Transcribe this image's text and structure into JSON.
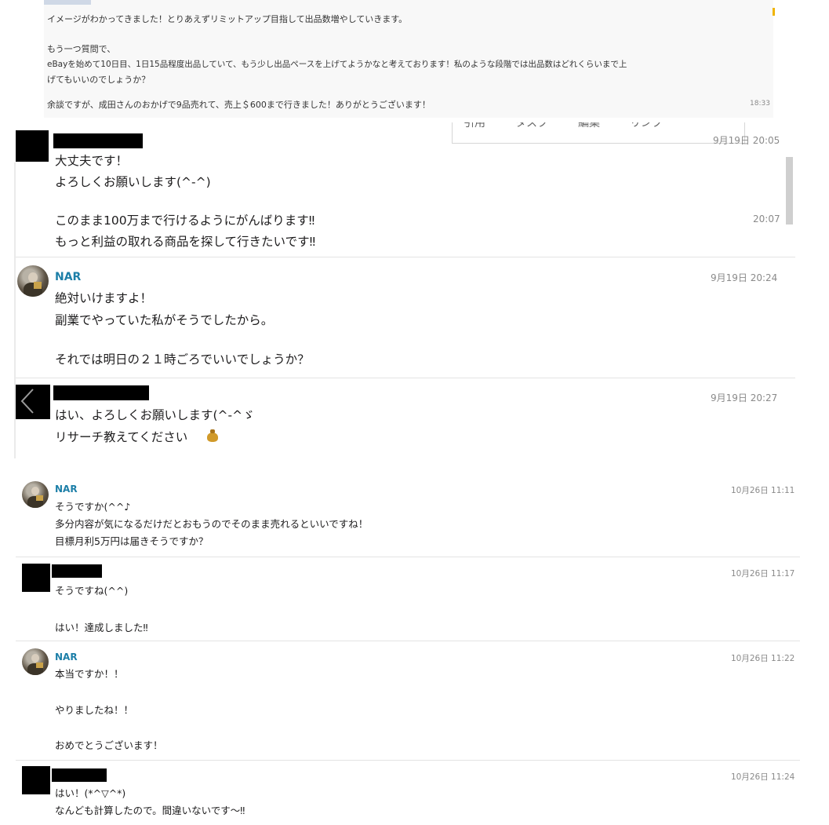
{
  "top_message": {
    "lines": [
      "イメージがわかってきました！とりあえずリミットアップ目指して出品数増やしていきます。",
      "もう一つ質問で、",
      "eBayを始めて10日目、1日15品程度出品していて、もう少し出品ペースを上げてようかなと考えております！私のような段階では出品数はどれくらいまで上",
      "げてもいいのでしょうか？",
      "余談ですが、成田さんのおかげで9品売れて、売上＄600まで行きました！ありがとうございます！"
    ],
    "time": "18:33"
  },
  "toolbar_overlay": {
    "items": [
      "引用",
      "タスク",
      "編集",
      "リンク"
    ]
  },
  "messages": [
    {
      "name": "",
      "time": "9月19日 20:05",
      "lines": [
        "大丈夫です！",
        "よろしくお願いします(^-^)"
      ]
    },
    {
      "time": "20:07",
      "lines": [
        "このまま100万まで行けるようにがんばります‼",
        "もっと利益の取れる商品を探して行きたいです‼"
      ]
    },
    {
      "name": "NAR",
      "time": "9月19日 20:24",
      "lines": [
        "絶対いけますよ！",
        "副業でやっていた私がそうでしたから。",
        "",
        "それでは明日の２１時ごろでいいでしょうか？"
      ]
    },
    {
      "name": "",
      "time": "9月19日 20:27",
      "lines": [
        "はい、よろしくお願いします(^-^ゞ",
        "リサーチ教えてください"
      ]
    },
    {
      "name": "NAR",
      "time": "10月26日 11:11",
      "lines": [
        "そうですか(^^♪",
        "多分内容が気になるだけだとおもうのでそのまま売れるといいですね！",
        "目標月利5万円は届きそうですか？"
      ]
    },
    {
      "name": "",
      "time": "10月26日 11:17",
      "lines": [
        "そうですね(^^)",
        "",
        "はい！達成しました‼"
      ]
    },
    {
      "name": "NAR",
      "time": "10月26日 11:22",
      "lines": [
        "本当ですか！！",
        "",
        "やりましたね！！",
        "",
        "おめでとうございます！"
      ]
    },
    {
      "name": "",
      "time": "10月26日 11:24",
      "lines": [
        "はい！(*^▽^*)",
        "なんども計算したので。間違いないです〜‼"
      ]
    }
  ],
  "colors": {
    "name": "#1d7fa8",
    "time": "#8a8a8a",
    "text": "#1d1c1d"
  }
}
